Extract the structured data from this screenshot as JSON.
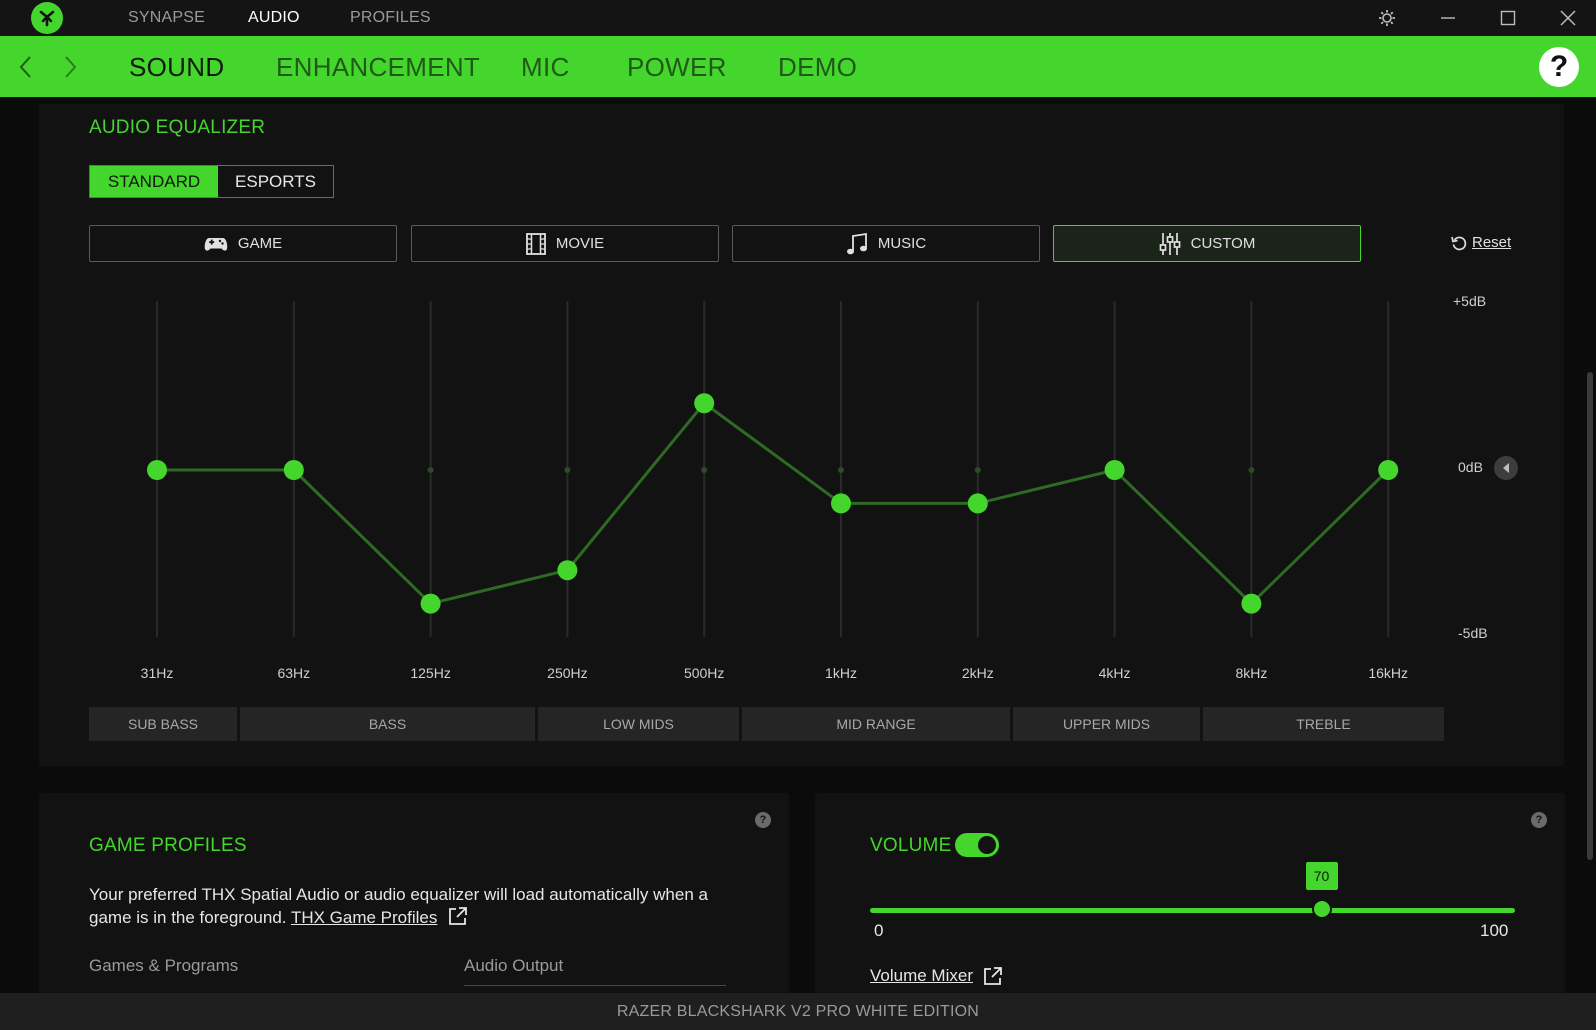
{
  "titlebar": {
    "nav": [
      "SYNAPSE",
      "AUDIO",
      "PROFILES"
    ],
    "active": "AUDIO"
  },
  "tabs": [
    "SOUND",
    "ENHANCEMENT",
    "MIC",
    "POWER",
    "DEMO"
  ],
  "active_tab": "SOUND",
  "help_label": "?",
  "equalizer": {
    "title": "AUDIO EQUALIZER",
    "modes": [
      "STANDARD",
      "ESPORTS"
    ],
    "active_mode": "STANDARD",
    "presets": [
      "GAME",
      "MOVIE",
      "MUSIC",
      "CUSTOM"
    ],
    "active_preset": "CUSTOM",
    "reset_label": "Reset",
    "db_labels": [
      "+5dB",
      "0dB",
      "-5dB"
    ],
    "frequencies": [
      "31Hz",
      "63Hz",
      "125Hz",
      "250Hz",
      "500Hz",
      "1kHz",
      "2kHz",
      "4kHz",
      "8kHz",
      "16kHz"
    ],
    "gains_db": [
      0,
      0,
      -4,
      -3,
      2,
      -1,
      -1,
      0,
      -4,
      0
    ],
    "bands": [
      "SUB BASS",
      "BASS",
      "LOW MIDS",
      "MID RANGE",
      "UPPER MIDS",
      "TREBLE"
    ]
  },
  "game_profiles": {
    "title": "GAME PROFILES",
    "text": "Your preferred THX Spatial Audio or audio equalizer will load automatically when a game is in the foreground.",
    "link_label": "THX Game Profiles",
    "col_games": "Games & Programs",
    "col_output": "Audio Output"
  },
  "volume": {
    "title": "VOLUME",
    "enabled": true,
    "value": "70",
    "min": "0",
    "max": "100",
    "mixer_label": "Volume Mixer"
  },
  "status": {
    "device": "RAZER BLACKSHARK V2 PRO WHITE EDITION"
  },
  "colors": {
    "accent": "#44d62c",
    "background": "#0b0b0b",
    "panel": "#121212"
  }
}
